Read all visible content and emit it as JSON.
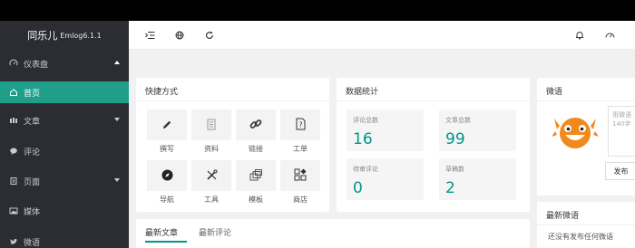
{
  "brand": {
    "name": "同乐儿",
    "version": "Emlog6.1.1"
  },
  "sidebar": {
    "items": [
      {
        "label": "仪表盘",
        "icon": "gauge-icon",
        "expanded": true
      },
      {
        "label": "首页",
        "icon": "home-icon",
        "active": true
      },
      {
        "label": "文章",
        "icon": "article-icon"
      },
      {
        "label": "评论",
        "icon": "comment-icon"
      },
      {
        "label": "页面",
        "icon": "page-icon"
      },
      {
        "label": "媒体",
        "icon": "media-icon"
      },
      {
        "label": "微语",
        "icon": "twitter-icon"
      }
    ]
  },
  "shortcuts": {
    "title": "快捷方式",
    "items": [
      {
        "label": "撰写",
        "icon": "pen-icon"
      },
      {
        "label": "资料",
        "icon": "document-icon"
      },
      {
        "label": "链接",
        "icon": "link-icon"
      },
      {
        "label": "工单",
        "icon": "question-doc-icon"
      },
      {
        "label": "导航",
        "icon": "compass-icon"
      },
      {
        "label": "工具",
        "icon": "tools-icon"
      },
      {
        "label": "模板",
        "icon": "template-icon"
      },
      {
        "label": "商店",
        "icon": "shop-icon"
      }
    ]
  },
  "stats": {
    "title": "数据统计",
    "items": [
      {
        "label": "评论总数",
        "value": "16"
      },
      {
        "label": "文章总数",
        "value": "99"
      },
      {
        "label": "待审评论",
        "value": "0"
      },
      {
        "label": "草稿数",
        "value": "2"
      }
    ]
  },
  "weiyu": {
    "title": "微语",
    "placeholder": "用微语\n140字",
    "publish": "发布"
  },
  "latest_weiyu": {
    "title": "最新微语",
    "empty": "还没有发布任何微语"
  },
  "articles": {
    "tabs": [
      "最新文章",
      "最新评论"
    ]
  },
  "colors": {
    "accent": "#009688",
    "sidebar": "#2b2d33",
    "active": "#1f9e8a",
    "mascot": "#f08a1c"
  }
}
